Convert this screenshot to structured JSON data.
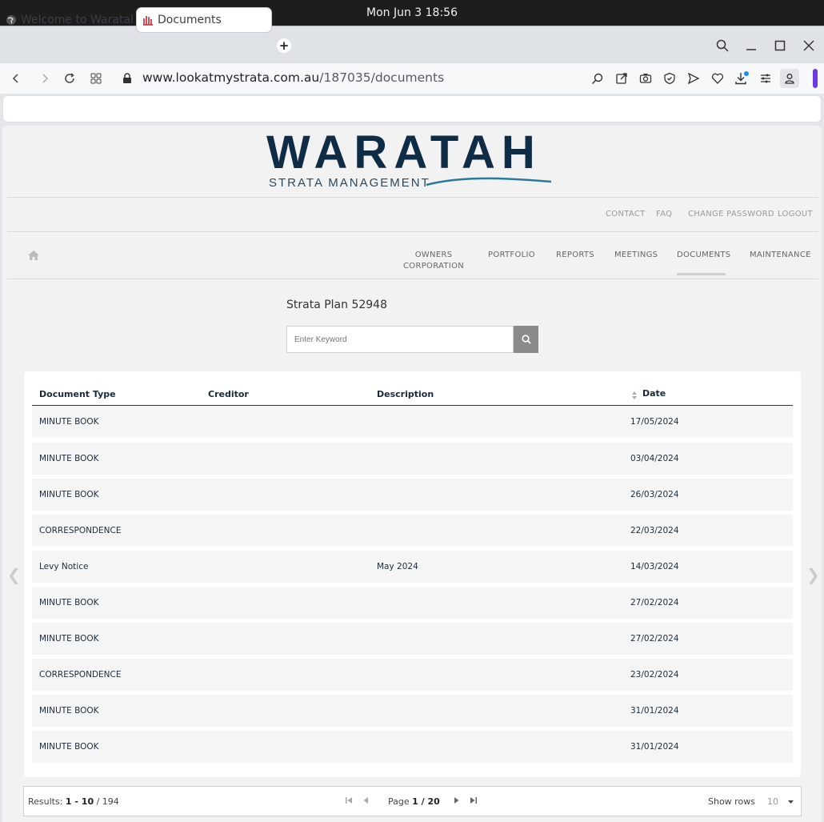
{
  "os": {
    "clock": "Mon Jun 3  18:56"
  },
  "browser": {
    "tabs": [
      {
        "label": "Welcome to Waratah",
        "active": false
      },
      {
        "label": "Documents",
        "active": true
      }
    ],
    "url_domain": "www.lookatmystrata.com.au",
    "url_path": "/187035/documents"
  },
  "site": {
    "logo_word": "WARATAH",
    "logo_sub": "STRATA MANAGEMENT",
    "util_links": [
      "CONTACT",
      "FAQ",
      "CHANGE PASSWORD",
      "LOGOUT"
    ],
    "nav": {
      "owners_line1": "OWNERS",
      "owners_line2": "CORPORATION",
      "portfolio": "PORTFOLIO",
      "reports": "REPORTS",
      "meetings": "MEETINGS",
      "documents": "DOCUMENTS",
      "maintenance": "MAINTENANCE",
      "active": "DOCUMENTS"
    },
    "plan_title": "Strata Plan 52948",
    "search_placeholder": "Enter Keyword"
  },
  "table": {
    "headers": {
      "type": "Document Type",
      "creditor": "Creditor",
      "description": "Description",
      "date": "Date"
    },
    "rows": [
      {
        "type": "MINUTE BOOK",
        "creditor": "",
        "description": "",
        "date": "17/05/2024"
      },
      {
        "type": "MINUTE BOOK",
        "creditor": "",
        "description": "",
        "date": "03/04/2024"
      },
      {
        "type": "MINUTE BOOK",
        "creditor": "",
        "description": "",
        "date": "26/03/2024"
      },
      {
        "type": "CORRESPONDENCE",
        "creditor": "",
        "description": "",
        "date": "22/03/2024"
      },
      {
        "type": "Levy Notice",
        "creditor": "",
        "description": "May 2024",
        "date": "14/03/2024"
      },
      {
        "type": "MINUTE BOOK",
        "creditor": "",
        "description": "",
        "date": "27/02/2024"
      },
      {
        "type": "MINUTE BOOK",
        "creditor": "",
        "description": "",
        "date": "27/02/2024"
      },
      {
        "type": "CORRESPONDENCE",
        "creditor": "",
        "description": "",
        "date": "23/02/2024"
      },
      {
        "type": "MINUTE BOOK",
        "creditor": "",
        "description": "",
        "date": "31/01/2024"
      },
      {
        "type": "MINUTE BOOK",
        "creditor": "",
        "description": "",
        "date": "31/01/2024"
      }
    ]
  },
  "pager": {
    "results_prefix": "Results: ",
    "results_range": "1 - 10",
    "results_total": " / 194",
    "page_prefix": "Page ",
    "page_current": "1 / 20",
    "show_rows_label": "Show rows",
    "show_rows_value": "10"
  }
}
